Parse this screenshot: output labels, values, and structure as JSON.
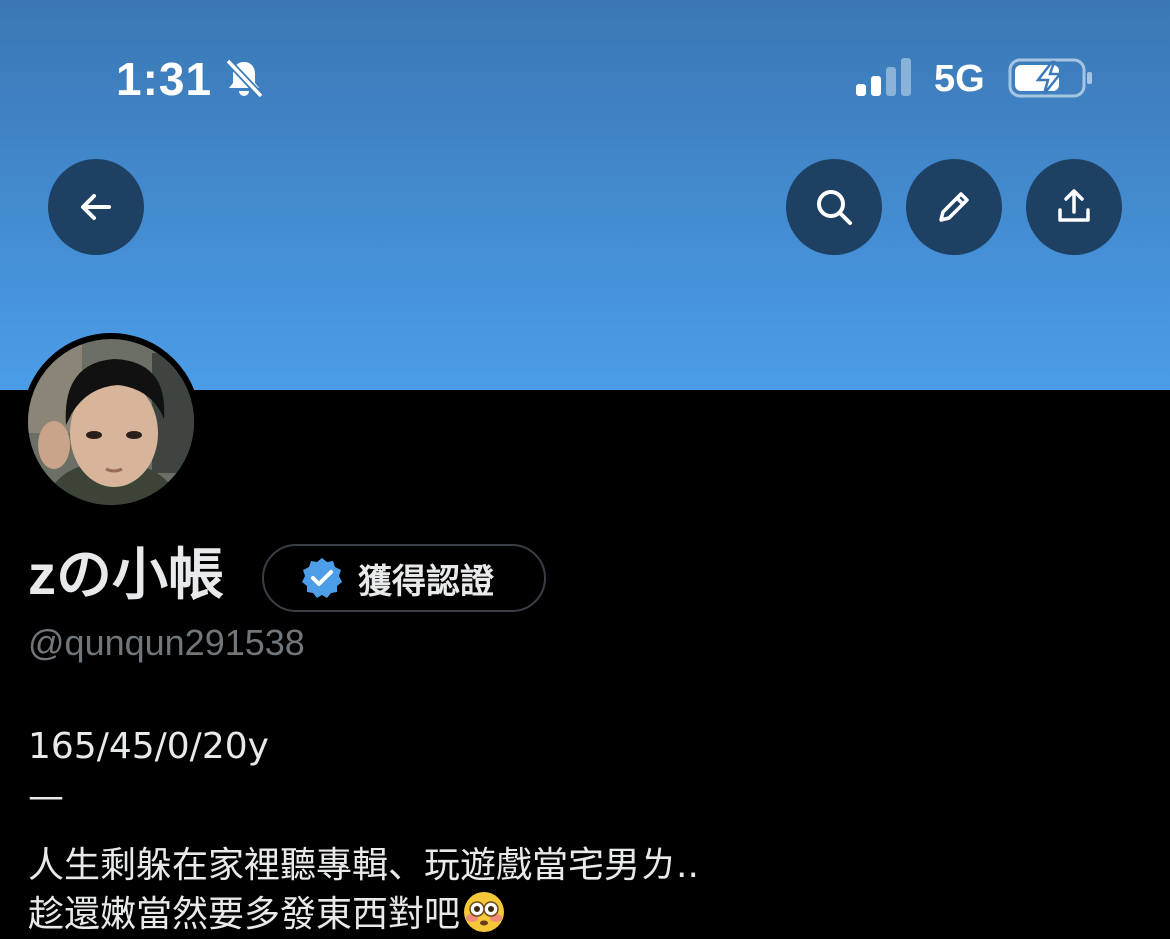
{
  "status_bar": {
    "time": "1:31",
    "network": "5G",
    "icons": [
      "bell-off-icon",
      "signal-icon",
      "battery-charging-icon"
    ]
  },
  "header": {
    "banner_colors": [
      "#3a77b4",
      "#4b9de8"
    ],
    "buttons": {
      "back": "back-arrow-icon",
      "search": "search-icon",
      "edit": "pencil-icon",
      "share": "share-icon"
    }
  },
  "profile": {
    "display_name": "zの小帳",
    "verify_label": "獲得認證",
    "handle": "@qunqun291538",
    "bio": [
      "165/45/0/20y",
      "—",
      "人生剩躲在家裡聽專輯、玩遊戲當宅男ㄌ..",
      "趁還嫩當然要多發東西對吧"
    ],
    "bio_emoji": "flushed-face-emoji"
  },
  "colors": {
    "background": "#000000",
    "text_primary": "#e7e9ea",
    "text_secondary": "#71767b",
    "verified_blue": "#4c9ee8",
    "button_bg": "#1e4063"
  }
}
